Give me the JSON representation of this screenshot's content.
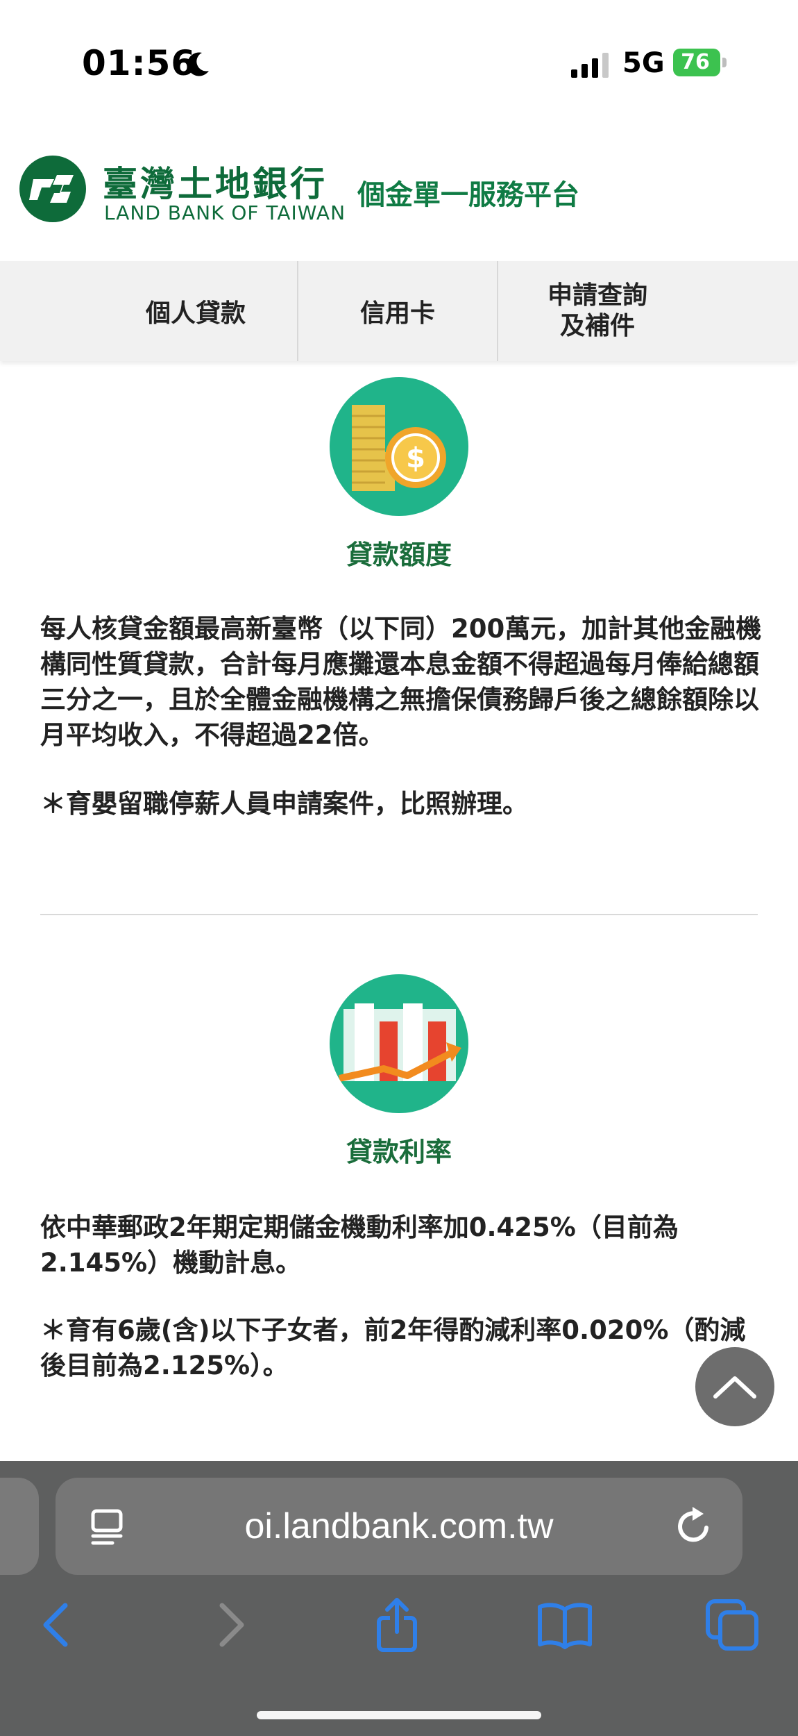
{
  "status_bar": {
    "time": "01:56",
    "network": "5G",
    "battery": "76"
  },
  "header": {
    "bank_name_cn": "臺灣土地銀行",
    "bank_name_en": "LAND BANK OF TAIWAN",
    "platform_title": "個金單一服務平台"
  },
  "menu": {
    "items": [
      {
        "label": "個人貸款"
      },
      {
        "label": "信用卡"
      },
      {
        "label": "申請查詢\n及補件"
      }
    ]
  },
  "sections": [
    {
      "title": "貸款額度",
      "icon": "coins-icon",
      "paragraphs": [
        "每人核貸金額最高新臺幣（以下同）200萬元，加計其他金融機構同性質貸款，合計每月應攤還本息金額不得超過每月俸給總額三分之一，且於全體金融機構之無擔保債務歸戶後之總餘額除以月平均收入，不得超過22倍。",
        "＊育嬰留職停薪人員申請案件，比照辦理。"
      ]
    },
    {
      "title": "貸款利率",
      "icon": "bar-chart-icon",
      "paragraphs": [
        "依中華郵政2年期定期儲金機動利率加0.425%（目前為2.145%）機動計息。",
        "＊育有6歲(含)以下子女者，前2年得酌減利率0.020%（酌減後目前為2.125%）。"
      ]
    }
  ],
  "browser": {
    "url": "oi.landbank.com.tw"
  },
  "colors": {
    "brand_green": "#0e6b3a",
    "icon_teal": "#20b48a",
    "battery_green": "#3cc24f",
    "ios_blue": "#2f7fe8",
    "browser_bg": "#5e5f5f"
  }
}
